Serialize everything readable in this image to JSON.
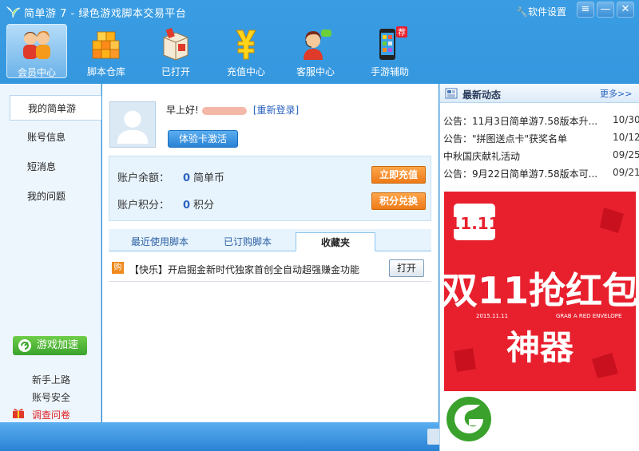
{
  "window": {
    "title": "简单游 7 - 绿色游戏脚本交易平台",
    "settings_label": "软件设置",
    "btn_menu": "≡",
    "btn_min": "—",
    "btn_close": "✕"
  },
  "toolbar": [
    {
      "label": "会员中心",
      "icon": "member-icon"
    },
    {
      "label": "脚本仓库",
      "icon": "cube-icon"
    },
    {
      "label": "已打开",
      "icon": "box-icon"
    },
    {
      "label": "充值中心",
      "icon": "yen-icon"
    },
    {
      "label": "客服中心",
      "icon": "service-icon"
    },
    {
      "label": "手游辅助",
      "icon": "phone-icon",
      "badge": "荐"
    }
  ],
  "sidebar": {
    "items": [
      "我的简单游",
      "账号信息",
      "短消息",
      "我的问题"
    ],
    "accel_label": "游戏加速",
    "footer": [
      "新手上路",
      "账号安全",
      "调查问卷"
    ]
  },
  "profile": {
    "greeting": "早上好!",
    "relogin": "[重新登录]",
    "trial_button": "体验卡激活"
  },
  "account": {
    "balance_label": "账户余额：",
    "balance_value": "0",
    "balance_unit": "简单币",
    "points_label": "账户积分：",
    "points_value": "0",
    "points_unit": "积分",
    "recharge_button": "立即充值",
    "exchange_button": "积分兑换"
  },
  "tabs": [
    "最近使用脚本",
    "已订购脚本",
    "收藏夹"
  ],
  "favorite": {
    "badge": "购",
    "text": "【快乐】开启掘金新时代独家首创全自动超强赚金功能",
    "open_button": "打开"
  },
  "news": {
    "title": "最新动态",
    "more": "更多>>",
    "items": [
      {
        "text": "公告：11月3日简单游7.58版本升...",
        "date": "10/30"
      },
      {
        "text": "公告：\"拼图送点卡\"获奖名单",
        "date": "10/12"
      },
      {
        "text": "中秋国庆献礼活动",
        "date": "09/25"
      },
      {
        "text": "公告：9月22日简单游7.58版本可...",
        "date": "09/21"
      }
    ]
  },
  "ad": {
    "badge": "11.11",
    "headline": "双11抢红包",
    "date": "2015.11.11",
    "slogan": "GRAB A RED ENVELOPE",
    "subline": "神器"
  },
  "colors": {
    "accent": "#2a82d4",
    "ad_red": "#e8202e",
    "orange": "#ee7a18",
    "green": "#3aa22c"
  }
}
